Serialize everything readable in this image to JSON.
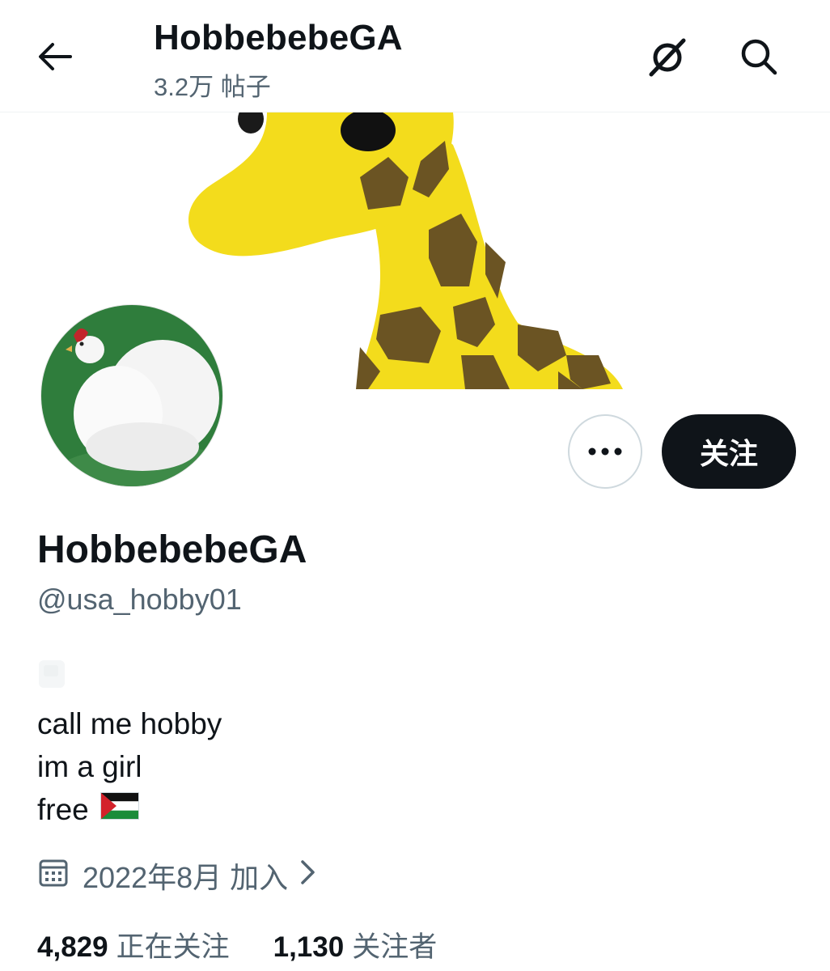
{
  "header": {
    "title": "HobbebebeGA",
    "post_count": "3.2万 帖子",
    "back_icon": "arrow-left-icon",
    "translate_icon": "translate-slash-icon",
    "search_icon": "search-icon"
  },
  "profile": {
    "display_name": "HobbebebeGA",
    "handle": "@usa_hobby01",
    "bio_lines": [
      "call me hobby",
      "im a girl",
      "free"
    ],
    "joined": "2022年8月 加入",
    "following_count": "4,829",
    "following_label": "正在关注",
    "followers_count": "1,130",
    "followers_label": "关注者"
  },
  "actions": {
    "follow_label": "关注",
    "more_icon": "ellipsis-icon"
  },
  "colors": {
    "primary_text": "#0f1419",
    "secondary_text": "#536471",
    "button_dark": "#0f1419",
    "banner_giraffe_yellow": "#f3dc1c",
    "banner_giraffe_spots": "#6b5423",
    "avatar_bg_green": "#2f7d3c"
  }
}
